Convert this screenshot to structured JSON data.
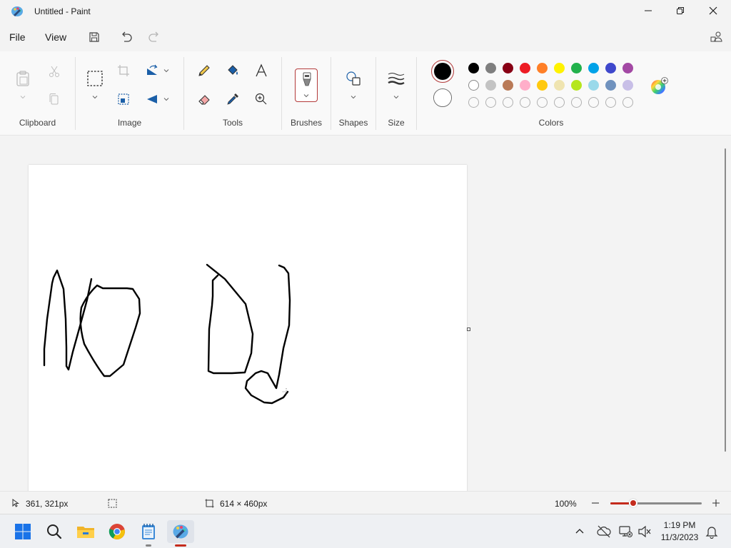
{
  "window": {
    "title": "Untitled - Paint"
  },
  "menu": {
    "file": "File",
    "view": "View"
  },
  "ribbon": {
    "groups": {
      "clipboard": "Clipboard",
      "image": "Image",
      "tools": "Tools",
      "brushes": "Brushes",
      "shapes": "Shapes",
      "size": "Size",
      "colors": "Colors"
    }
  },
  "colors": {
    "primary": "#000000",
    "secondary": "#ffffff",
    "row1": [
      "#000000",
      "#7f7f7f",
      "#880015",
      "#ed1c24",
      "#ff7f27",
      "#fff200",
      "#22b14c",
      "#00a2e8",
      "#3f48cc",
      "#a349a4"
    ],
    "row2": [
      "#ffffff",
      "#c3c3c3",
      "#b97a57",
      "#ffaec9",
      "#ffc90e",
      "#efe4b0",
      "#b5e61d",
      "#99d9ea",
      "#7092be",
      "#c8bfe7"
    ],
    "row3": [
      "",
      "",
      "",
      "",
      "",
      "",
      "",
      "",
      "",
      ""
    ]
  },
  "status": {
    "cursor_position": "361, 321px",
    "canvas_size": "614 × 460px",
    "zoom": "100%",
    "zoom_fraction": 0.25
  },
  "taskbar": {
    "time": "1:19 PM",
    "date": "11/3/2023"
  }
}
